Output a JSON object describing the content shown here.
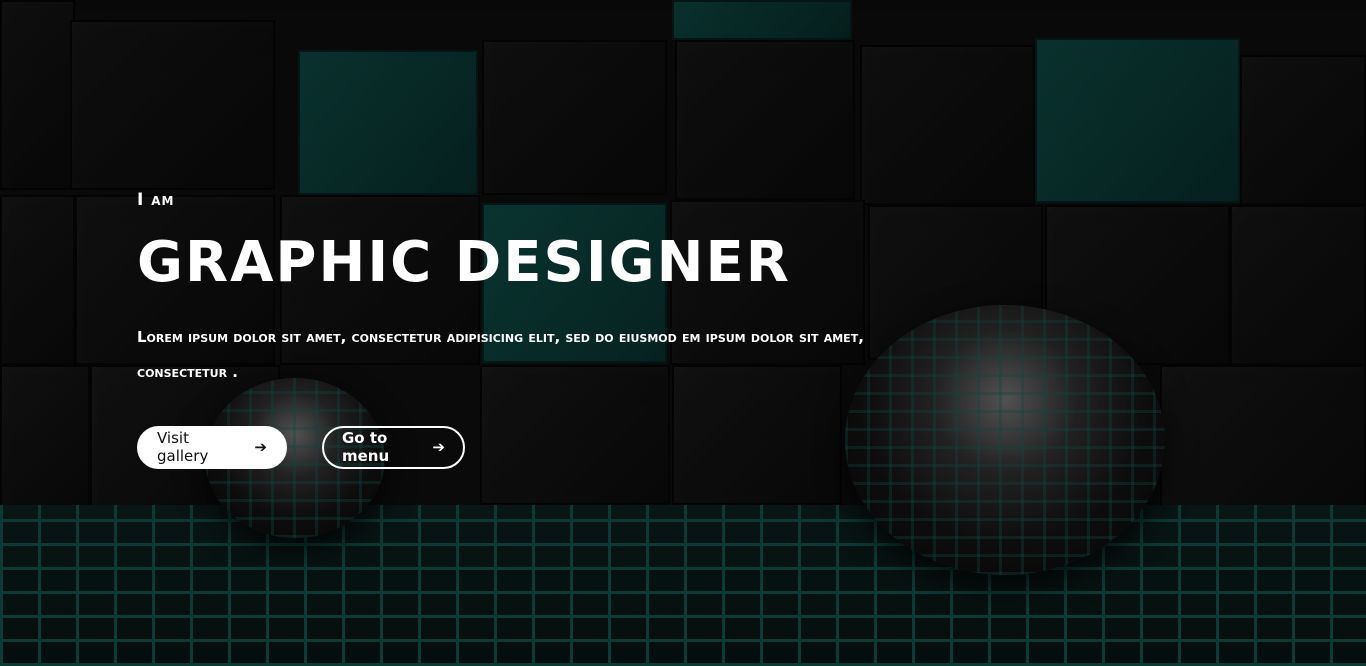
{
  "hero": {
    "eyebrow": "I am",
    "title": "GRAPHIC DESIGNER",
    "description": "Lorem ipsum dolor sit amet, consectetur adipisicing elit, sed do eiusmod em ipsum dolor sit amet, consectetur ."
  },
  "buttons": {
    "visit_gallery": "Visit gallery",
    "go_to_menu": "Go to menu",
    "arrow_glyph": "➔"
  },
  "icons": {
    "visit_gallery": "arrow-right-icon",
    "go_to_menu": "arrow-right-icon"
  },
  "colors": {
    "accent_teal": "#0e4a45",
    "text": "#ffffff",
    "button_solid_bg": "#ffffff"
  }
}
